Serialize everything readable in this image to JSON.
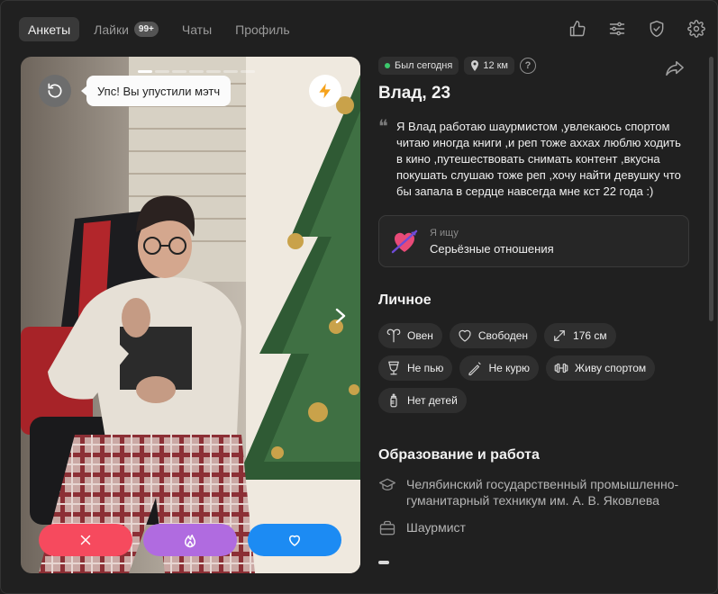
{
  "nav": {
    "tabs": [
      {
        "label": "Анкеты",
        "active": true
      },
      {
        "label": "Лайки",
        "badge": "99+"
      },
      {
        "label": "Чаты"
      },
      {
        "label": "Профиль"
      }
    ],
    "icons": [
      "thumbs-up-icon",
      "filter-sliders-icon",
      "shield-check-icon",
      "gear-icon"
    ]
  },
  "photo": {
    "photo_count": 7,
    "current_photo": 1,
    "undo_tooltip": "Упс! Вы упустили мэтч",
    "buttons": [
      "dislike",
      "superlike",
      "like"
    ]
  },
  "profile": {
    "status": "Был сегодня",
    "distance": "12 км",
    "help_icon": "?",
    "name": "Влад, 23",
    "bio": "Я Влад работаю шаурмистом ,увлекаюсь спортом читаю иногда книги ,и реп тоже аххах люблю ходить в кино ,путешествовать снимать контент ,вкусна покушать слушаю тоже реп ,хочу найти девушку что бы запала в сердце навсегда мне кст 22 года :)",
    "looking_label": "Я ищу",
    "looking_value": "Серьёзные отношения",
    "personal_title": "Личное",
    "personal_tags": [
      {
        "icon": "aries-icon",
        "label": "Овен"
      },
      {
        "icon": "heart-icon",
        "label": "Свободен"
      },
      {
        "icon": "height-icon",
        "label": "176 см"
      },
      {
        "icon": "glass-icon",
        "label": "Не пью"
      },
      {
        "icon": "no-smoking-icon",
        "label": "Не курю"
      },
      {
        "icon": "dumbbell-icon",
        "label": "Живу спортом"
      },
      {
        "icon": "baby-bottle-icon",
        "label": "Нет детей"
      }
    ],
    "education_title": "Образование и работа",
    "education": "Челябинский государственный промышленно-гуманитарный техникум им. А. В. Яковлева",
    "job": "Шаурмист"
  },
  "colors": {
    "dislike": "#f64a5e",
    "superlike": "#b06be0",
    "like": "#1c8bf3",
    "online": "#3cc86c"
  }
}
